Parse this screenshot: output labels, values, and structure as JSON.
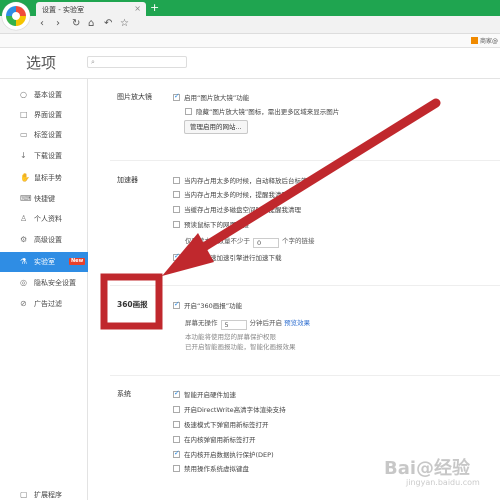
{
  "browser": {
    "tab_title": "设置 - 实验室",
    "tab_close": "×",
    "new_tab": "+",
    "nav": {
      "back": "‹",
      "forward": "›",
      "reload": "↻",
      "home": "⌂",
      "undo": "↶",
      "star": "☆"
    },
    "bookmark_label": "商家@"
  },
  "header": {
    "title": "选项",
    "search_icon": "⌕"
  },
  "sidebar": {
    "items": [
      {
        "icon": "○",
        "label": "基本设置"
      },
      {
        "icon": "□",
        "label": "界面设置"
      },
      {
        "icon": "▭",
        "label": "标签设置"
      },
      {
        "icon": "↓",
        "label": "下载设置"
      },
      {
        "icon": "✋",
        "label": "鼠标手势"
      },
      {
        "icon": "⌨",
        "label": "快捷键"
      },
      {
        "icon": "♙",
        "label": "个人资料"
      },
      {
        "icon": "⚙",
        "label": "高级设置"
      },
      {
        "icon": "⚗",
        "label": "实验室",
        "badge": "New"
      },
      {
        "icon": "◎",
        "label": "隐私安全设置"
      },
      {
        "icon": "⊘",
        "label": "广告过滤"
      }
    ],
    "bottom": {
      "icon": "▢",
      "label": "扩展程序"
    }
  },
  "sections": {
    "image_zoom": {
      "title": "图片放大镜",
      "enable": "启用“图片放大镜”功能",
      "hide": "隐藏“图片放大镜”图标，需出更多区域来显示图片",
      "manage_button": "管理启用的网站..."
    },
    "accelerator": {
      "title": "加速器",
      "options": [
        "当内存占用太多的时候，自动释放后台标签",
        "当内存占用太多的时候，提醒我清理",
        "当缓存占用过多磁盘空间时，提醒我清理",
        "预读鼠标下的网页链接"
      ],
      "only_read_prefix": "仅预读文字数量不少于",
      "only_read_value": "0",
      "only_read_suffix": "个字的链接",
      "prefetch": "使用云加速加速引擎进行加速下载"
    },
    "screensaver": {
      "title": "360画报",
      "enable": "开启“360画报”功能",
      "idle_prefix": "屏幕无操作",
      "idle_value": "5",
      "idle_suffix": "分钟后开启",
      "preview": "预览效果",
      "note1": "本功能将使用您的屏幕保护权限",
      "note2": "已开启智能画报功能，智能化画报效果"
    },
    "system": {
      "title": "系统",
      "options": [
        {
          "label": "智能开启硬件加速",
          "checked": true
        },
        {
          "label": "开启DirectWrite高清字体渲染支持",
          "checked": false
        },
        {
          "label": "极速模式下弹窗用新标签打开",
          "checked": false
        },
        {
          "label": "在内核弹窗用新标签打开",
          "checked": false
        },
        {
          "label": "在内核开启数据执行保护(DEP)",
          "checked": true
        },
        {
          "label": "禁用操作系统虚拟键盘",
          "checked": false
        }
      ]
    }
  },
  "watermark": {
    "main": "Bai@经验",
    "sub": "jingyan.baidu.com"
  },
  "colors": {
    "accent": "#2f8de4",
    "annotation": "#c0282d",
    "tabbar": "#1fa550"
  }
}
